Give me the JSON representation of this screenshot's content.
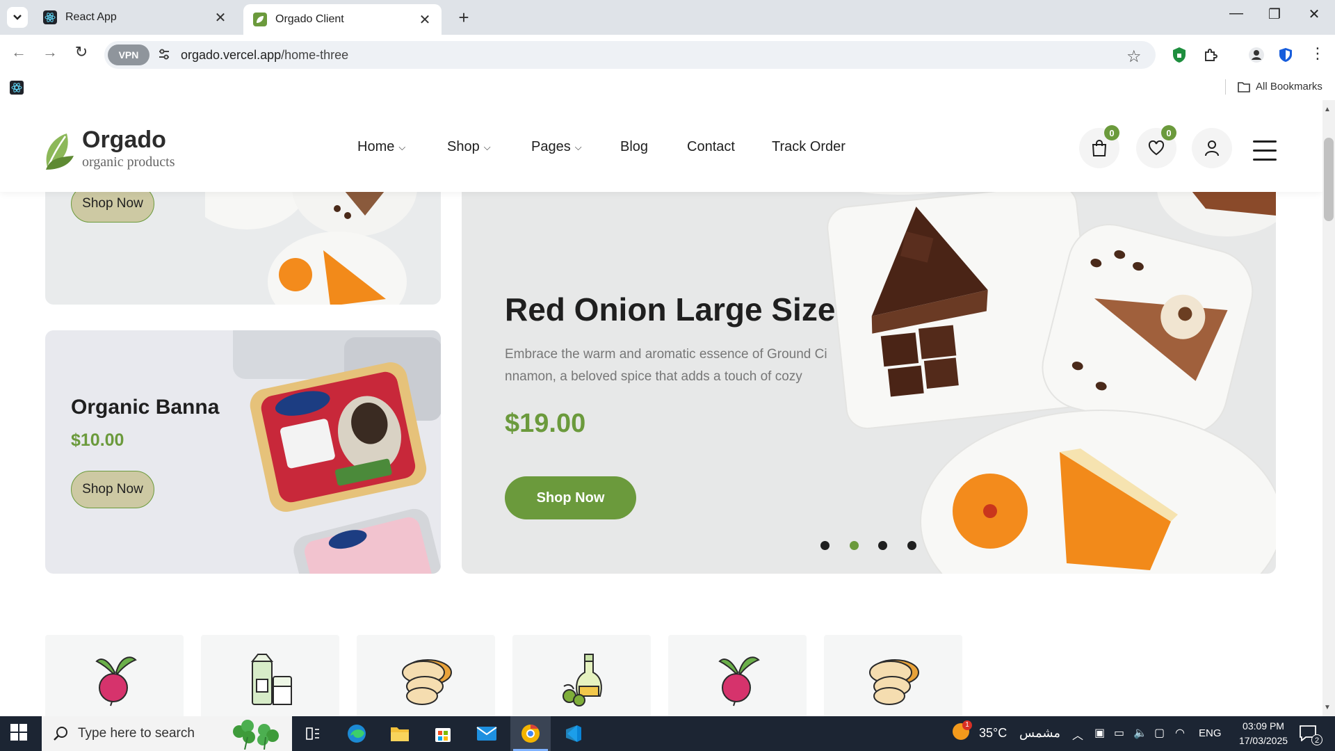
{
  "browser": {
    "tabs": [
      {
        "title": "React App",
        "active": false
      },
      {
        "title": "Orgado Client",
        "active": true
      }
    ],
    "url_domain": "orgado.vercel.app",
    "url_path": "/home-three",
    "vpn_label": "VPN",
    "bookmarks_label": "All Bookmarks"
  },
  "site": {
    "logo_name": "Orgado",
    "logo_tagline": "organic products",
    "nav": [
      {
        "label": "Home",
        "dropdown": true
      },
      {
        "label": "Shop",
        "dropdown": true
      },
      {
        "label": "Pages",
        "dropdown": true
      },
      {
        "label": "Blog",
        "dropdown": false
      },
      {
        "label": "Contact",
        "dropdown": false
      },
      {
        "label": "Track Order",
        "dropdown": false
      }
    ],
    "cart_count": "0",
    "wishlist_count": "0"
  },
  "promo_top": {
    "button": "Shop Now"
  },
  "promo_banna": {
    "title": "Organic Banna",
    "price": "$10.00",
    "button": "Shop Now"
  },
  "hero": {
    "title": "Red Onion Large Size",
    "description": "Embrace the warm and aromatic essence of Ground Ci nnamon, a beloved spice that adds a touch of cozy",
    "price": "$19.00",
    "button": "Shop Now",
    "slides": 4,
    "active_slide": 2
  },
  "categories": [
    {
      "icon": "beetroot-icon"
    },
    {
      "icon": "milk-icon"
    },
    {
      "icon": "bread-icon"
    },
    {
      "icon": "oil-bottle-icon"
    },
    {
      "icon": "beetroot-icon"
    },
    {
      "icon": "bread-icon"
    }
  ],
  "taskbar": {
    "search_placeholder": "Type here to search",
    "weather": "35°C",
    "weather_desc": "مشمس",
    "language": "ENG",
    "time": "03:09 PM",
    "date": "17/03/2025",
    "notification_count": "2",
    "weather_badge": "1"
  },
  "colors": {
    "accent": "#6b9a3c",
    "accent_soft": "#cdc9a3",
    "tabbar": "#dfe3e8",
    "taskbar": "#1c2533"
  }
}
